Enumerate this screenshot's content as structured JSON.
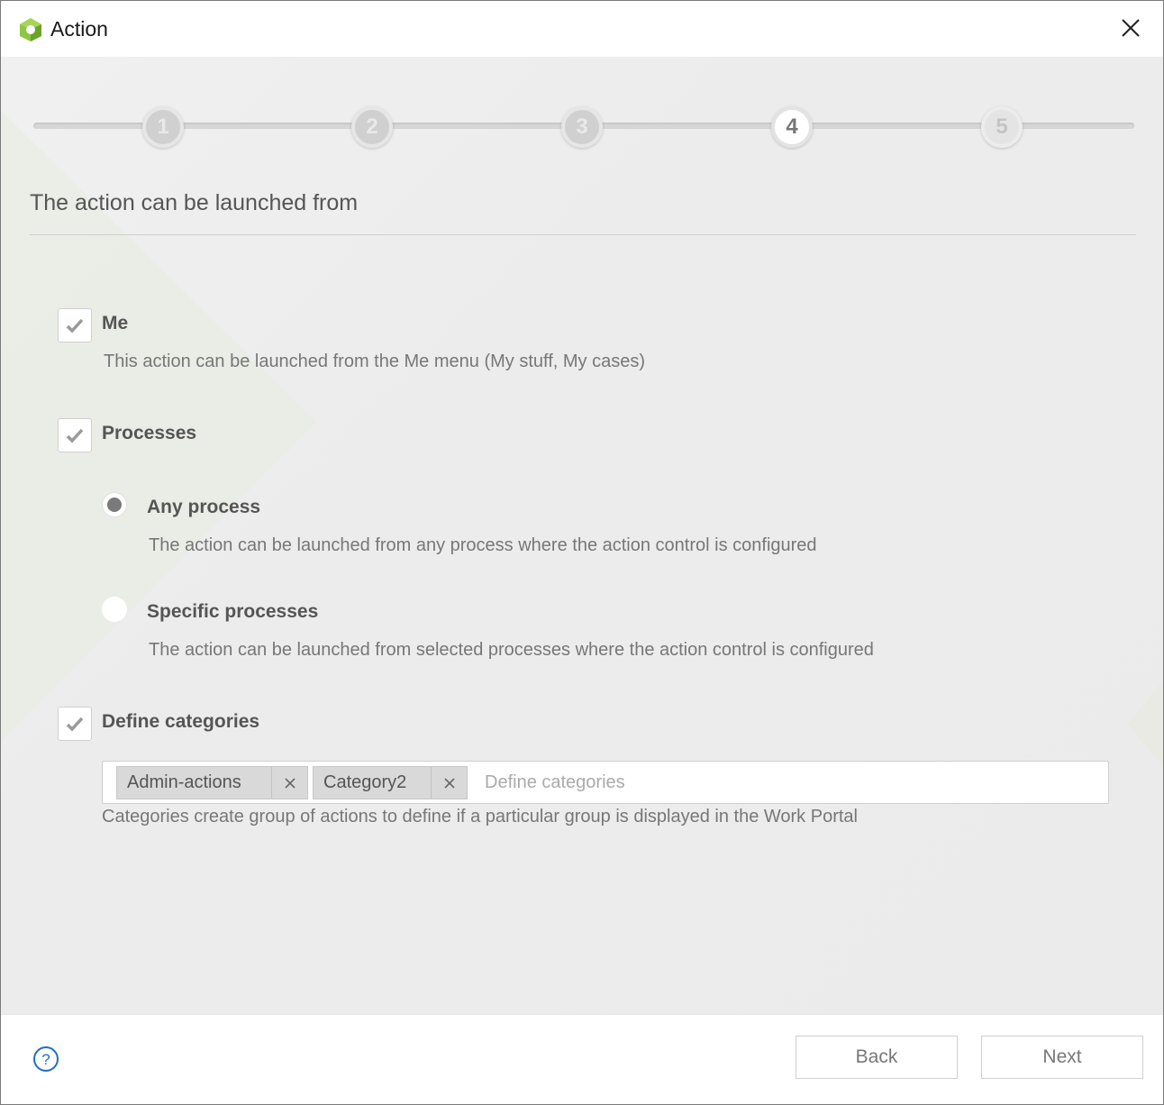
{
  "window": {
    "title": "Action"
  },
  "stepper": {
    "steps": [
      "1",
      "2",
      "3",
      "4",
      "5"
    ],
    "current": 4
  },
  "section": {
    "title": "The action can be launched from"
  },
  "options": {
    "me": {
      "label": "Me",
      "checked": true,
      "description": "This action can be launched from the Me menu (My stuff, My cases)"
    },
    "processes": {
      "label": "Processes",
      "checked": true
    },
    "any_process": {
      "label": "Any process",
      "selected": true,
      "description": "The action can be launched from any process where the action control is configured"
    },
    "specific_processes": {
      "label": "Specific processes",
      "selected": false,
      "description": "The action can be launched from selected processes where the action control is configured"
    },
    "define_categories": {
      "label": "Define categories",
      "checked": true
    }
  },
  "categories": {
    "tags": [
      "Admin-actions",
      "Category2"
    ],
    "placeholder": "Define categories",
    "help": "Categories create group of actions to define if a particular group is displayed in the Work Portal"
  },
  "footer": {
    "back_label": "Back",
    "next_label": "Next"
  },
  "colors": {
    "logo_green": "#8dc63f",
    "help_blue": "#1e6fc4"
  }
}
